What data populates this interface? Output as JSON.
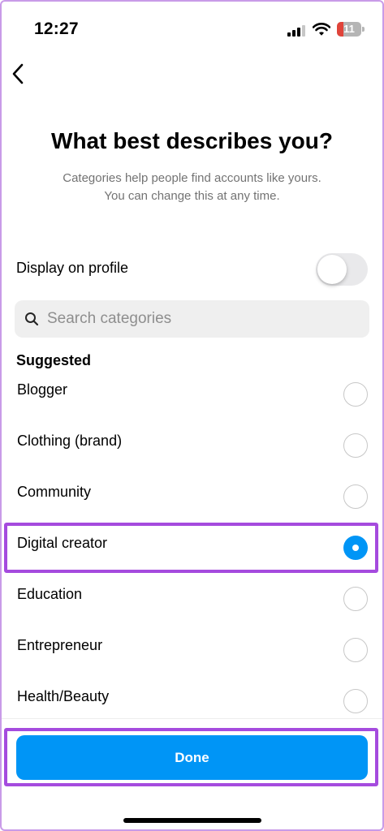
{
  "status_bar": {
    "time": "12:27",
    "battery_level": "11",
    "battery_color": "#e0443a",
    "icons": [
      "signal-icon",
      "wifi-icon",
      "battery-icon"
    ]
  },
  "nav": {
    "back_icon": "chevron-left-icon"
  },
  "header": {
    "title": "What best describes you?",
    "subtitle_line1": "Categories help people find accounts like yours.",
    "subtitle_line2": "You can change this at any time."
  },
  "display_on_profile": {
    "label": "Display on profile",
    "enabled": false
  },
  "search": {
    "placeholder": "Search categories",
    "value": "",
    "icon": "search-icon"
  },
  "suggested": {
    "heading": "Suggested",
    "selected_index": 3,
    "items": [
      {
        "label": "Blogger",
        "selected": false
      },
      {
        "label": "Clothing (brand)",
        "selected": false
      },
      {
        "label": "Community",
        "selected": false
      },
      {
        "label": "Digital creator",
        "selected": true
      },
      {
        "label": "Education",
        "selected": false
      },
      {
        "label": "Entrepreneur",
        "selected": false
      },
      {
        "label": "Health/Beauty",
        "selected": false
      }
    ]
  },
  "done_button": {
    "label": "Done"
  },
  "colors": {
    "accent": "#0095f6",
    "annotation": "#a54bde"
  }
}
